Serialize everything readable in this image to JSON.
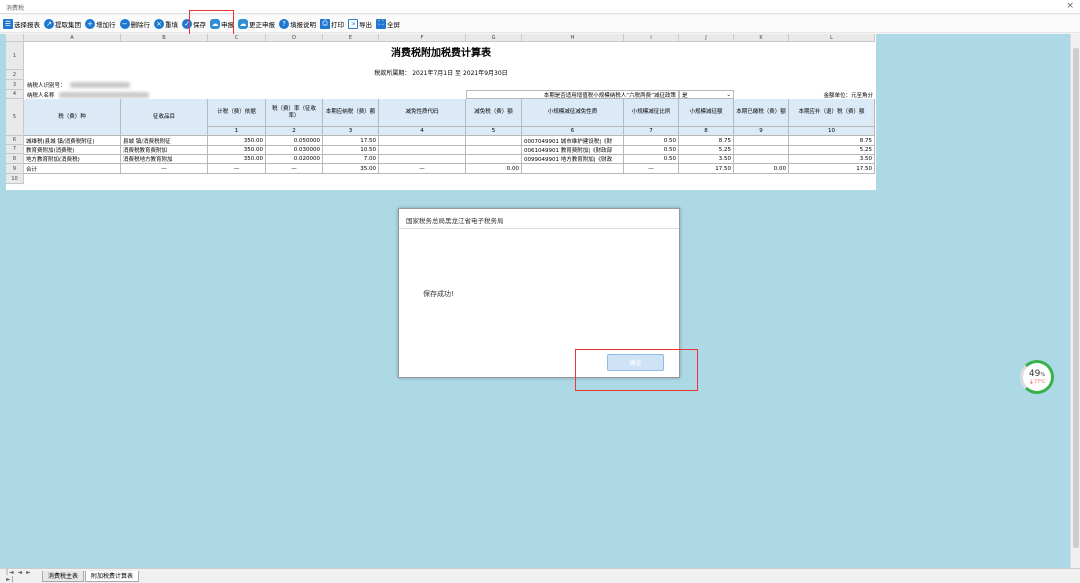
{
  "window": {
    "title": "消费税",
    "close": "×"
  },
  "toolbar": [
    {
      "label": "选择报表",
      "icon": "list-icon",
      "glyph": "☰"
    },
    {
      "label": "提取集团",
      "icon": "share-icon",
      "glyph": "↗"
    },
    {
      "label": "增加行",
      "icon": "add-row-icon",
      "glyph": "+"
    },
    {
      "label": "删除行",
      "icon": "delete-row-icon",
      "glyph": "−"
    },
    {
      "label": "重填",
      "icon": "clear-icon",
      "glyph": "×"
    },
    {
      "label": "保存",
      "icon": "save-check-icon",
      "glyph": "✓"
    },
    {
      "label": "申报",
      "icon": "cloud-upload-icon",
      "glyph": "☁"
    },
    {
      "label": "更正申报",
      "icon": "cloud-correct-icon",
      "glyph": "☁"
    },
    {
      "label": "填报说明",
      "icon": "help-icon",
      "glyph": "?"
    },
    {
      "label": "打印",
      "icon": "printer-icon",
      "glyph": "⎙"
    },
    {
      "label": "导出",
      "icon": "export-icon",
      "glyph": "⇲"
    },
    {
      "label": "全屏",
      "icon": "fullscreen-icon",
      "glyph": "⛶"
    }
  ],
  "columns": [
    "A",
    "B",
    "C",
    "D",
    "E",
    "F",
    "G",
    "H",
    "I",
    "J",
    "K",
    "L"
  ],
  "sheet": {
    "title": "消费税附加税费计算表",
    "period": "税款所属期：  2021年7月1日 至 2021年9月30日",
    "taxpayer_id_label": "纳税人识别号：",
    "taxpayer_name_label": "纳税人名称",
    "policy_question": "本期是否适用增值税小规模纳税人“六税两费”减征政策",
    "policy_answer": "是",
    "unit": "金额单位：元至角分",
    "headers": [
      "税（费）种",
      "征收品目",
      "计税（费）依据",
      "税（费）率（征收率）",
      "本期应纳税（费）额",
      "减免性质代码",
      "减免税（费）额",
      "小规模减征减免性质",
      "小规模减征比例",
      "小规模减征额",
      "本期已缴税（费）额",
      "本期应补（退）税（费）额"
    ],
    "header_nums": [
      "",
      "",
      "1",
      "2",
      "3",
      "4",
      "5",
      "6",
      "7",
      "8",
      "9",
      "10"
    ],
    "rows": [
      [
        "城维税(县城 镇/消费税附征)",
        "县城 镇/消费税附征",
        "350.00",
        "0.050000",
        "17.50",
        "",
        "",
        "0007049901 城市维护建设税|《财",
        "0.50",
        "8.75",
        "",
        "8.75"
      ],
      [
        "教育费附加(消费税)",
        "消费税教育费附加",
        "350.00",
        "0.030000",
        "10.50",
        "",
        "",
        "0061049901 教育费附加|《财政部",
        "0.50",
        "5.25",
        "",
        "5.25"
      ],
      [
        "地方教育附加(消费税)",
        "消费税地方教育附加",
        "350.00",
        "0.020000",
        "7.00",
        "",
        "",
        "0099049901 地方教育附加|《财政",
        "0.50",
        "3.50",
        "",
        "3.50"
      ],
      [
        "合计",
        "—",
        "—",
        "—",
        "35.00",
        "—",
        "0.00",
        "",
        "—",
        "17.50",
        "0.00",
        "17.50"
      ]
    ]
  },
  "dialog": {
    "title": "国家税务总局黑龙江省电子税务局",
    "message": "保存成功!",
    "ok": "确定"
  },
  "sheet_tabs": [
    "消费税主表",
    "附加税费计算表"
  ],
  "nav": "|◄ ◄ ► ►|",
  "widget": {
    "percent": "49",
    "unit": "%",
    "temp": "🌡77°C"
  },
  "accent": "#1e78d2"
}
